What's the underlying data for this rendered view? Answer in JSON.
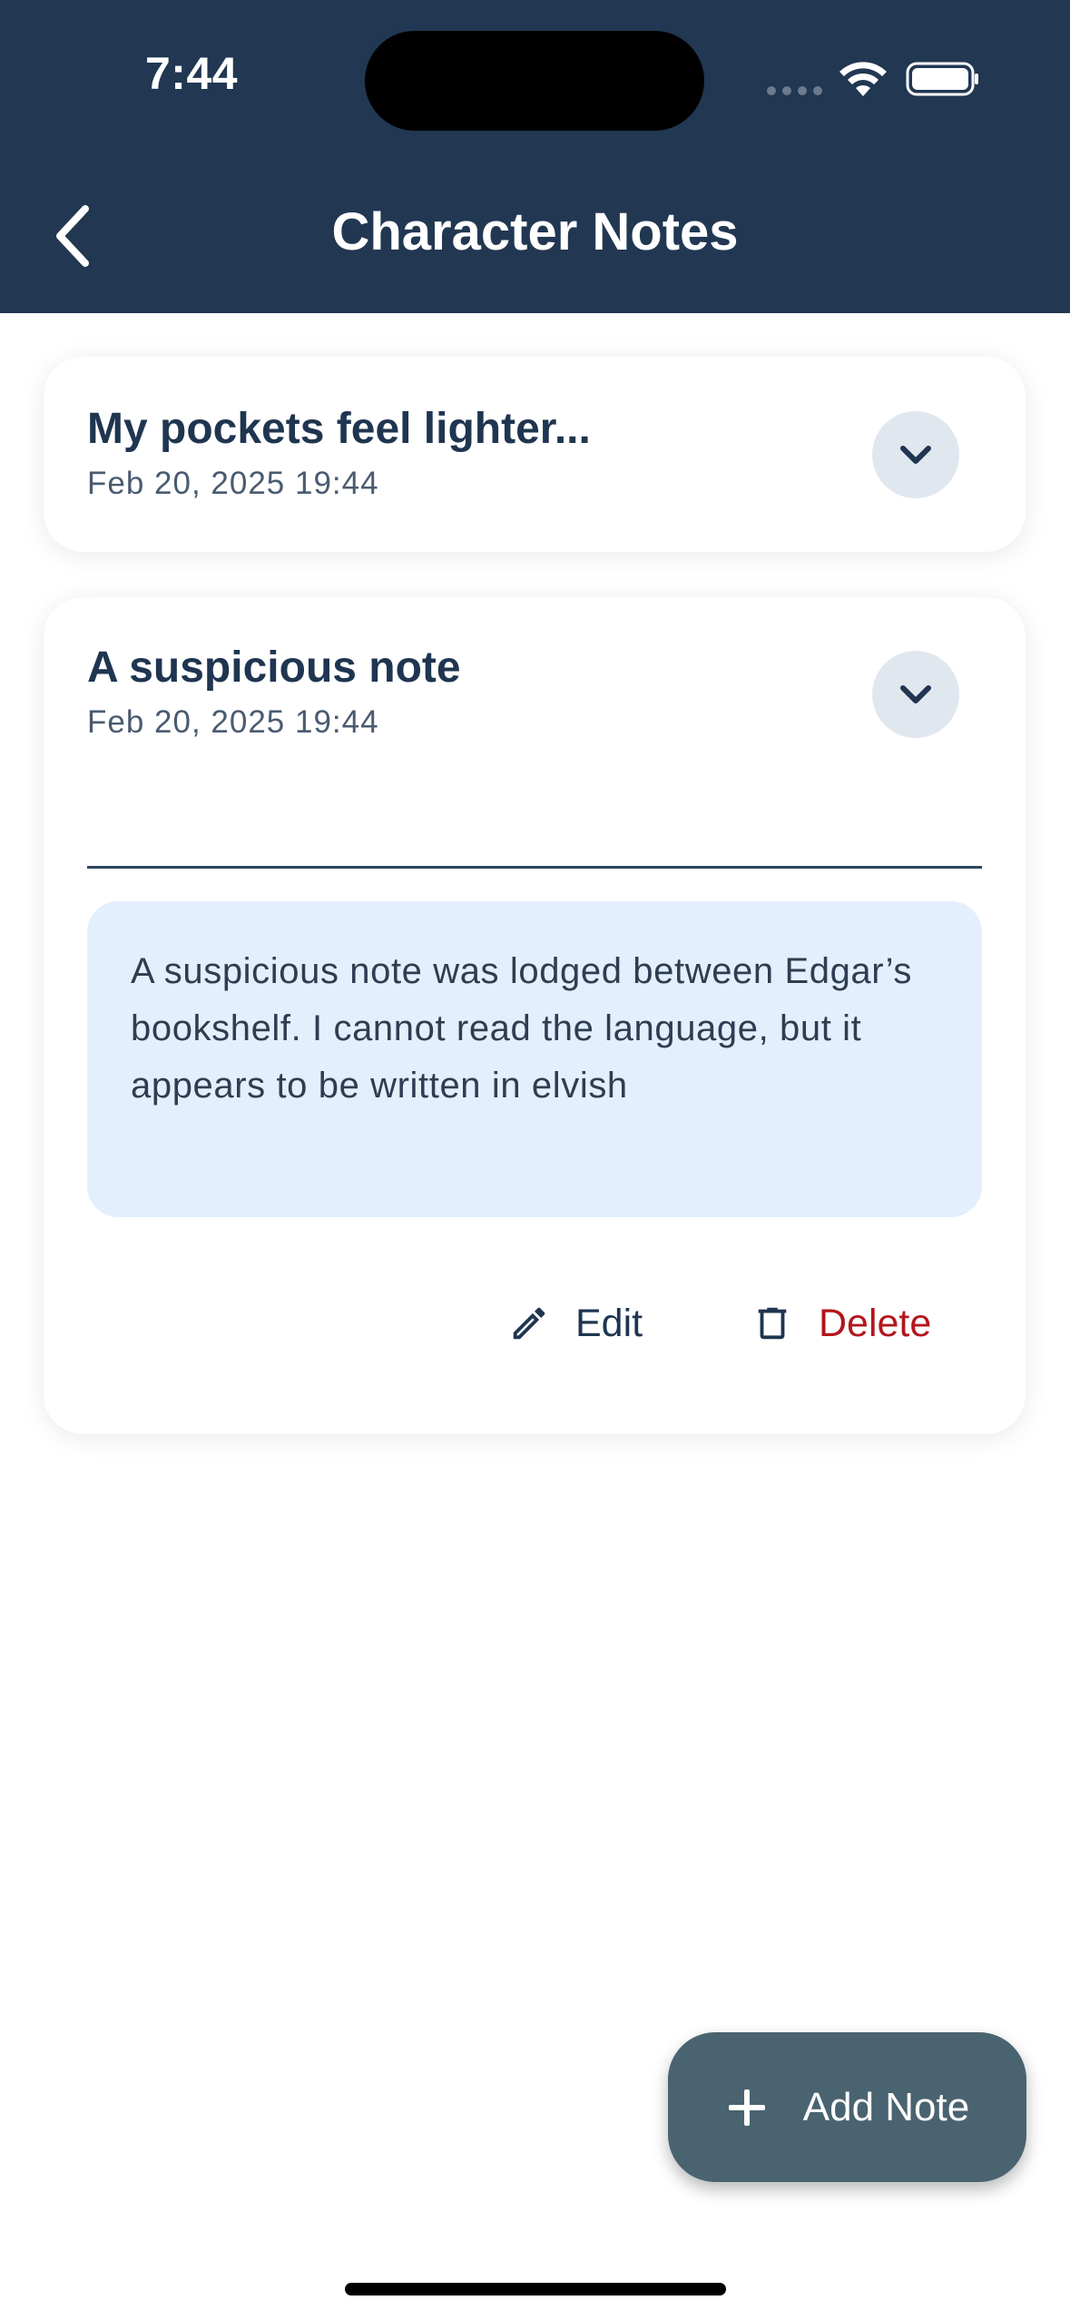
{
  "status_bar": {
    "time": "7:44"
  },
  "header": {
    "title": "Character Notes",
    "back_icon": "chevron-left-icon",
    "background": "#213752"
  },
  "notes": [
    {
      "title": "My pockets feel lighter...",
      "date": "Feb 20, 2025 19:44",
      "expanded": false,
      "toggle_icon": "chevron-down-icon"
    },
    {
      "title": "A suspicious note",
      "date": "Feb 20, 2025 19:44",
      "expanded": true,
      "toggle_icon": "chevron-down-icon",
      "body": "A suspicious note was lodged between Edgar’s bookshelf. I cannot read the language, but it appears to be written in elvish",
      "actions": {
        "edit_label": "Edit",
        "edit_icon": "pencil-icon",
        "delete_label": "Delete",
        "delete_icon": "trash-icon"
      }
    }
  ],
  "fab": {
    "label": "Add Note",
    "icon": "plus-icon",
    "background": "#4a6370"
  },
  "colors": {
    "accent": "#213752",
    "danger": "#b3161d",
    "note_body_bg": "#e3effd"
  }
}
